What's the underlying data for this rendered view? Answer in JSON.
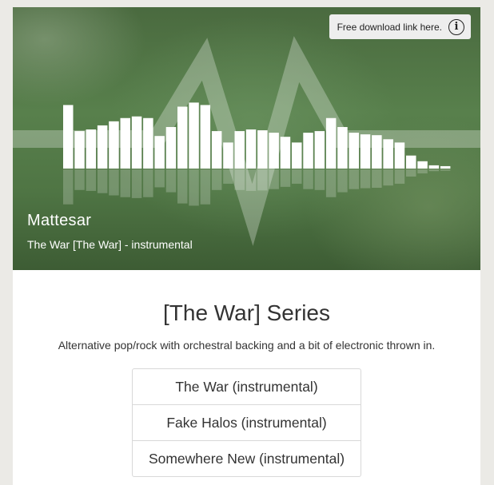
{
  "player": {
    "download_label": "Free download link here.",
    "info_icon": "info-icon",
    "artist": "Mattesar",
    "track_title": "The War [The War] - instrumental",
    "waveform_levels": [
      0.78,
      0.46,
      0.48,
      0.53,
      0.58,
      0.62,
      0.64,
      0.62,
      0.4,
      0.51,
      0.76,
      0.81,
      0.78,
      0.46,
      0.32,
      0.46,
      0.48,
      0.47,
      0.44,
      0.39,
      0.32,
      0.44,
      0.46,
      0.62,
      0.51,
      0.44,
      0.42,
      0.41,
      0.36,
      0.32,
      0.16,
      0.09,
      0.04,
      0.03
    ]
  },
  "series": {
    "title": "[The War] Series",
    "description": "Alternative pop/rock with orchestral backing and a bit of electronic thrown in."
  },
  "tracks": [
    {
      "label": "The War (instrumental)"
    },
    {
      "label": "Fake Halos (instrumental)"
    },
    {
      "label": "Somewhere New (instrumental)"
    }
  ]
}
